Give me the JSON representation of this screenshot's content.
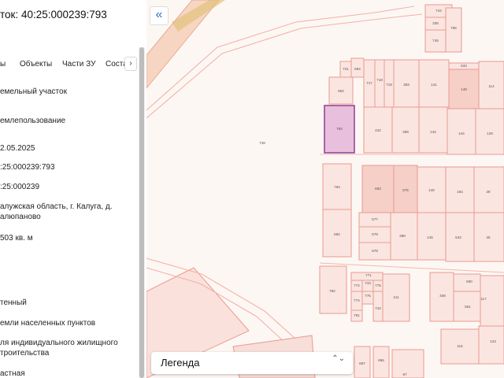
{
  "panel": {
    "title": "ток: 40:25:000239:793",
    "tabs": [
      "ы",
      "Объекты",
      "Части ЗУ",
      "Соста"
    ],
    "tabs_scroll": "›",
    "fields": [
      "емельный участок",
      "емлепользование",
      "2.05.2025",
      ":25:000239:793",
      ":25:000239",
      "алужская область, г. Калуга, д. алюпаново",
      "503 кв. м",
      "тенный",
      "емли населенных пунктов",
      "ля индивидуального жилищного троительства",
      "астная"
    ]
  },
  "map": {
    "collapse_icon": "«",
    "legend_label": "Легенда",
    "legend_arrows": "⌃⌄",
    "selected_plot": "793",
    "plot_labels": [
      "744",
      "335",
      "745",
      "785",
      "694",
      "721",
      "652",
      "717",
      "718",
      "719",
      "393",
      "141",
      "633",
      "149",
      "114",
      "793",
      "422",
      "389",
      "142",
      "144",
      "129",
      "748",
      "764",
      "683",
      "675",
      "140",
      "184",
      "28",
      "577",
      "578",
      "398",
      "145",
      "543",
      "25",
      "578",
      "682",
      "771",
      "772",
      "743",
      "776",
      "775",
      "774",
      "791",
      "742",
      "211",
      "408",
      "590",
      "591",
      "117",
      "123",
      "116",
      "782",
      "697",
      "696",
      "87"
    ]
  }
}
